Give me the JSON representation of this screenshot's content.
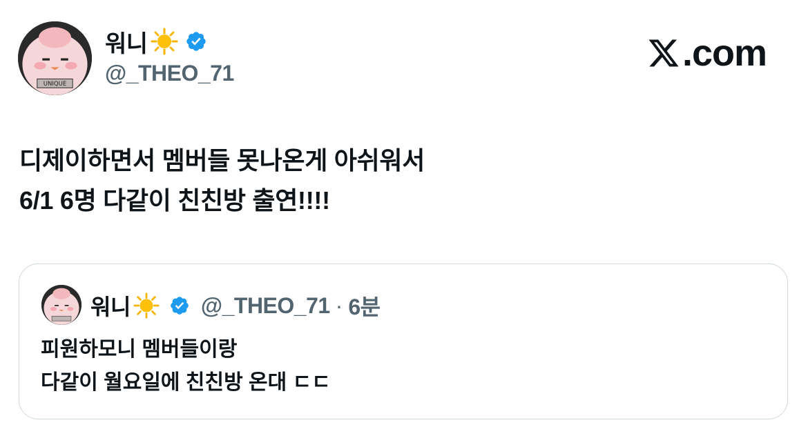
{
  "tweet": {
    "author": {
      "display_name": "워니",
      "handle": "@_THEO_71",
      "emoji_icon": "sun-emoji",
      "verified_icon": "verified-badge-icon",
      "verified_color": "#1d9bf0"
    },
    "body_lines": [
      "디제이하면서 멤버들 못나온게 아쉬워서",
      "6/1 6명 다같이 친친방 출연!!!!"
    ]
  },
  "brand": {
    "label": ".com",
    "icon": "x-logo-icon"
  },
  "quoted_tweet": {
    "author": {
      "display_name": "워니",
      "handle": "@_THEO_71",
      "separator": "·",
      "time": "6분"
    },
    "body_lines": [
      "피원하모니 멤버들이랑",
      "다같이 월요일에 친친방 온대 ㄷㄷ"
    ]
  },
  "colors": {
    "text": "#0f1419",
    "secondary_text": "#536471",
    "border": "#cfd9de",
    "sun": "#f7b500"
  }
}
